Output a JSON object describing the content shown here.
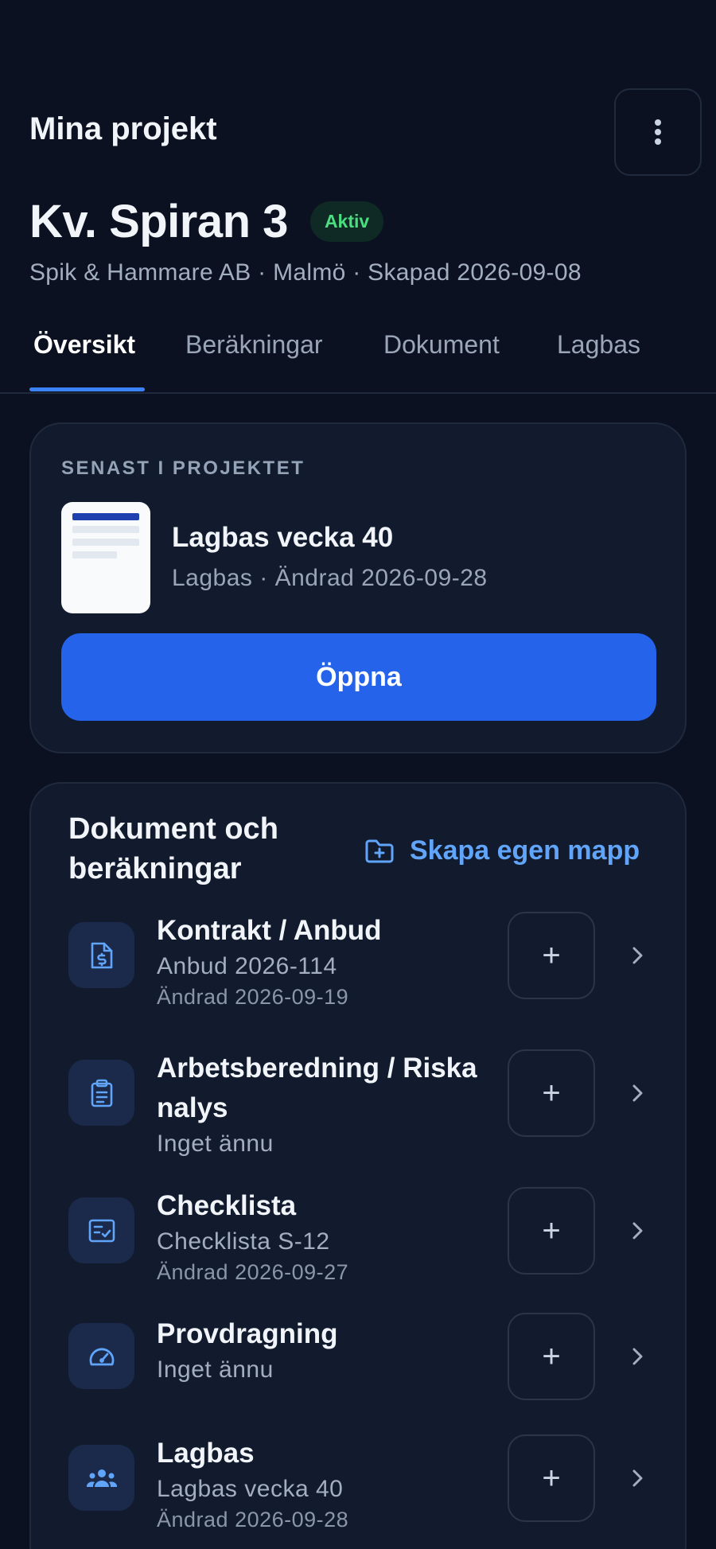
{
  "header": {
    "title": "Mina projekt",
    "menu_icon": "more-vertical-icon"
  },
  "project": {
    "name": "Kv. Spiran 3",
    "status": "Aktiv",
    "meta": "Spik & Hammare AB · Malmö · Skapad 2026-09-08"
  },
  "tabs": [
    {
      "label": "Översikt",
      "active": true
    },
    {
      "label": "Beräkningar",
      "active": false
    },
    {
      "label": "Dokument",
      "active": false
    },
    {
      "label": "Lagbas",
      "active": false
    }
  ],
  "recent": {
    "section_label": "SENAST I PROJEKTET",
    "title": "Lagbas vecka 40",
    "meta": "Lagbas · Ändrad 2026-09-28",
    "open_label": "Öppna"
  },
  "documents": {
    "title": "Dokument och beräkningar",
    "create_folder_label": "Skapa egen mapp",
    "items": [
      {
        "icon": "file-dollar-icon",
        "title": "Kontrakt / Anbud",
        "subtitle": "Anbud 2026-114",
        "date": "Ändrad 2026-09-19"
      },
      {
        "icon": "clipboard-icon",
        "title": "Arbetsberedning / Riska nalys",
        "subtitle": "Inget ännu",
        "date": ""
      },
      {
        "icon": "checklist-icon",
        "title": "Checklista",
        "subtitle": "Checklista S-12",
        "date": "Ändrad 2026-09-27"
      },
      {
        "icon": "gauge-icon",
        "title": "Provdragning",
        "subtitle": "Inget ännu",
        "date": ""
      },
      {
        "icon": "team-icon",
        "title": "Lagbas",
        "subtitle": "Lagbas vecka 40",
        "date": "Ändrad 2026-09-28"
      }
    ],
    "add_label": "+"
  },
  "colors": {
    "background": "#0b1120",
    "card": "#121b2e",
    "accent": "#2563eb",
    "link": "#60a5fa",
    "status_active": "#4ade80"
  }
}
